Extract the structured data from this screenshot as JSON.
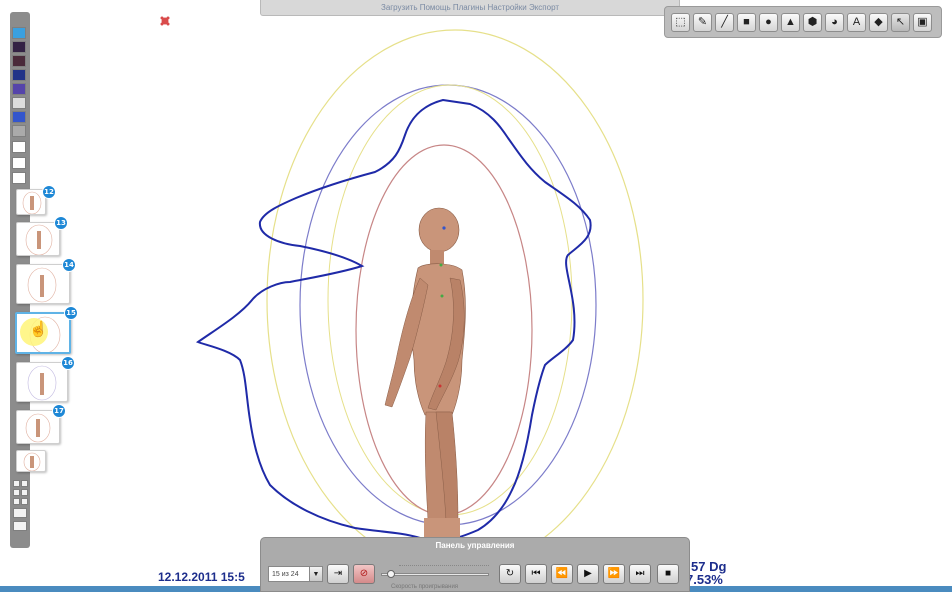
{
  "window": {
    "title_strip": "Загрузить Помощь Плагины Настройки Экспорт"
  },
  "corner_icon": {
    "name": "settings-red-icon",
    "color": "#d94b4b"
  },
  "drawing_toolbar": {
    "tools": [
      {
        "name": "select-rect-icon",
        "glyph": "⬚"
      },
      {
        "name": "pen-icon",
        "glyph": "✎"
      },
      {
        "name": "line-icon",
        "glyph": "╱"
      },
      {
        "name": "square-icon",
        "glyph": "■"
      },
      {
        "name": "circle-icon",
        "glyph": "●"
      },
      {
        "name": "triangle-icon",
        "glyph": "▲"
      },
      {
        "name": "hexagon-icon",
        "glyph": "⬢"
      },
      {
        "name": "fill-icon",
        "glyph": "◕"
      },
      {
        "name": "text-icon",
        "glyph": "A"
      },
      {
        "name": "eraser-icon",
        "glyph": "◆"
      },
      {
        "name": "pointer-icon",
        "glyph": "↖",
        "active": true
      },
      {
        "name": "save-icon",
        "glyph": "▣"
      }
    ]
  },
  "sidebar": {
    "thumbnails": [
      {
        "badge": "12"
      },
      {
        "badge": "13"
      },
      {
        "badge": "14"
      },
      {
        "badge": "15",
        "selected": true
      },
      {
        "badge": "16"
      },
      {
        "badge": "17"
      },
      {
        "badge": ""
      }
    ]
  },
  "status": {
    "timestamp": "12.12.2011 15:5",
    "dg_value": "57 Dg",
    "percent_value": "7.53%"
  },
  "control_panel": {
    "title": "Панель управления",
    "slide_selector": "15 из 24",
    "speed_label": "Скорость проигрывания",
    "progress": 0.05,
    "buttons": [
      {
        "name": "refresh-button",
        "glyph": "↻"
      },
      {
        "name": "first-button",
        "glyph": "⏮"
      },
      {
        "name": "rewind-button",
        "glyph": "⏪"
      },
      {
        "name": "play-button",
        "glyph": "▶"
      },
      {
        "name": "fast-forward-button",
        "glyph": "⏩"
      },
      {
        "name": "last-button",
        "glyph": "⏭"
      },
      {
        "name": "stop-button",
        "glyph": "■"
      }
    ]
  },
  "colors": {
    "aura_outline": "#1f2aa8",
    "ring_yellow": "#e6e08a",
    "ring_blue": "#7878c8",
    "ring_pink": "#c78686",
    "body": "#c9957a",
    "accent_blue": "#1e88d6"
  }
}
